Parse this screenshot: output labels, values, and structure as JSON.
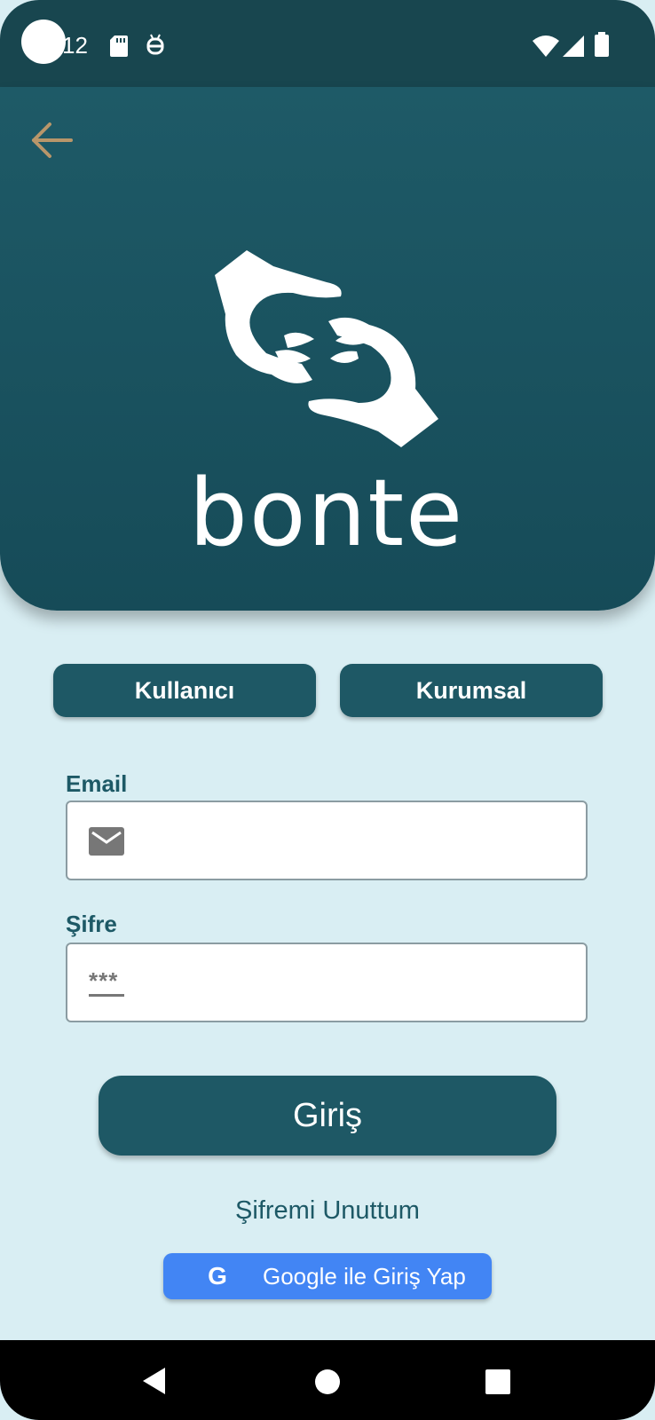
{
  "status_bar": {
    "time": "12",
    "icons": [
      "sd-card-icon",
      "android-debug-icon",
      "wifi-icon",
      "signal-icon",
      "battery-icon"
    ]
  },
  "header": {
    "back_icon": "arrow-left-icon",
    "logo_text": "bonte"
  },
  "tabs": [
    {
      "label": "Kullanıcı"
    },
    {
      "label": "Kurumsal"
    }
  ],
  "form": {
    "email_label": "Email",
    "email_icon": "mail-icon",
    "password_label": "Şifre",
    "password_icon": "password-icon",
    "password_icon_text": "***"
  },
  "login_button": "Giriş",
  "forgot_password": "Şifremi Unuttum",
  "google_button": {
    "icon_letter": "G",
    "label": "Google ile Giriş Yap"
  },
  "nav_bar": {
    "icons": [
      "back-triangle-icon",
      "home-circle-icon",
      "recents-square-icon"
    ]
  },
  "colors": {
    "primary": "#1e5865",
    "header_bg": "#1a525e",
    "page_bg": "#d9eef3",
    "back_arrow": "#b8966a",
    "google_blue": "#4285f4"
  }
}
